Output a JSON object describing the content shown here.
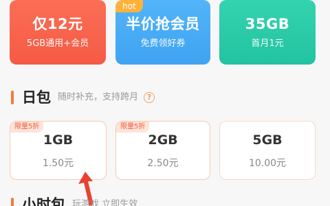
{
  "promos": [
    {
      "title": "仅12元",
      "subtitle": "5GB通用+会员",
      "color": "#f55a45"
    },
    {
      "title": "半价抢会员",
      "subtitle": "免费领好券",
      "badge": "hot",
      "color": "#3fa3f2"
    },
    {
      "title": "35GB",
      "subtitle": "首月1元",
      "color": "#22c3a0"
    }
  ],
  "daily_section": {
    "title": "日包",
    "subtitle": "随时补充，支持跨月",
    "help_icon": "?"
  },
  "daily_cards": [
    {
      "tag": "限量5折",
      "data": "1GB",
      "price": "1.50元"
    },
    {
      "tag": "限量5折",
      "data": "2GB",
      "price": "2.50元"
    },
    {
      "data": "5GB",
      "price": "10.00元"
    }
  ],
  "next_section": {
    "title": "小时包",
    "subtitle": "玩游戏  立即生效"
  },
  "annotation": {
    "arrow_color": "#e8422e",
    "icon": "red-arrow-icon"
  }
}
